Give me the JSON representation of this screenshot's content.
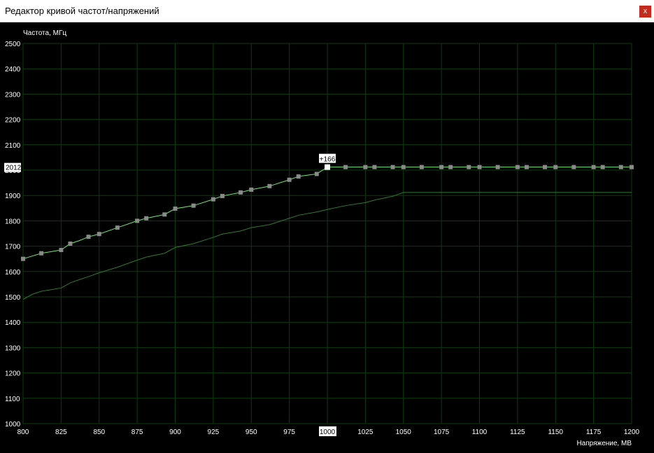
{
  "window": {
    "title": "Редактор кривой частот/напряжений",
    "close_label": "x"
  },
  "chart_data": {
    "type": "line",
    "ylabel": "Частота, МГц",
    "xlabel": "Напряжение, МВ",
    "xlim": [
      800,
      1200
    ],
    "ylim": [
      1000,
      2500
    ],
    "x_ticks": [
      800,
      825,
      850,
      875,
      900,
      925,
      950,
      975,
      1000,
      1025,
      1050,
      1075,
      1100,
      1125,
      1150,
      1175,
      1200
    ],
    "y_ticks": [
      1000,
      1100,
      1200,
      1300,
      1400,
      1500,
      1600,
      1700,
      1800,
      1900,
      2000,
      2100,
      2200,
      2300,
      2400,
      2500
    ],
    "grid": true,
    "highlight": {
      "x": 1000,
      "y": 2012,
      "y_label": "2012",
      "x_label": "1000",
      "offset_label": "+166"
    },
    "series": [
      {
        "color": "#6ee86e",
        "markers": true,
        "x": [
          800,
          812,
          825,
          831,
          837,
          843,
          850,
          862,
          875,
          881,
          893,
          900,
          912,
          925,
          931,
          943,
          950,
          962,
          975,
          981,
          993,
          1000,
          1012,
          1025,
          1031,
          1043,
          1050,
          1062,
          1075,
          1081,
          1093,
          1100,
          1112,
          1125,
          1131,
          1143,
          1150,
          1162,
          1175,
          1181,
          1193,
          1200
        ],
        "y": [
          1650,
          1672,
          1685,
          1710,
          1722,
          1737,
          1748,
          1773,
          1800,
          1810,
          1825,
          1848,
          1860,
          1885,
          1898,
          1912,
          1923,
          1937,
          1962,
          1975,
          1985,
          2012,
          2012,
          2012,
          2012,
          2012,
          2012,
          2012,
          2012,
          2012,
          2012,
          2012,
          2012,
          2012,
          2012,
          2012,
          2012,
          2012,
          2012,
          2012,
          2012,
          2012
        ],
        "marker_x": [
          812,
          825,
          831,
          843,
          850,
          862,
          875,
          881,
          893,
          900,
          912,
          925,
          931,
          943,
          950,
          962,
          975,
          981,
          993,
          1012,
          1025,
          1031,
          1043,
          1050,
          1062,
          1075,
          1081,
          1093,
          1100,
          1112,
          1125,
          1131,
          1143,
          1150,
          1162,
          1175,
          1181,
          1193,
          1200
        ]
      },
      {
        "color": "#2f7a2f",
        "markers": false,
        "x": [
          800,
          806,
          812,
          818,
          825,
          831,
          837,
          843,
          850,
          862,
          875,
          881,
          893,
          900,
          912,
          925,
          931,
          943,
          950,
          962,
          975,
          981,
          993,
          1000,
          1012,
          1025,
          1031,
          1043,
          1050,
          1062,
          1075,
          1100,
          1125,
          1150,
          1175,
          1200
        ],
        "y": [
          1490,
          1510,
          1522,
          1528,
          1535,
          1555,
          1568,
          1580,
          1595,
          1617,
          1645,
          1657,
          1672,
          1695,
          1710,
          1735,
          1748,
          1760,
          1773,
          1785,
          1810,
          1822,
          1835,
          1845,
          1860,
          1872,
          1882,
          1897,
          1912,
          1912,
          1912,
          1912,
          1912,
          1912,
          1912,
          1912
        ]
      }
    ]
  }
}
